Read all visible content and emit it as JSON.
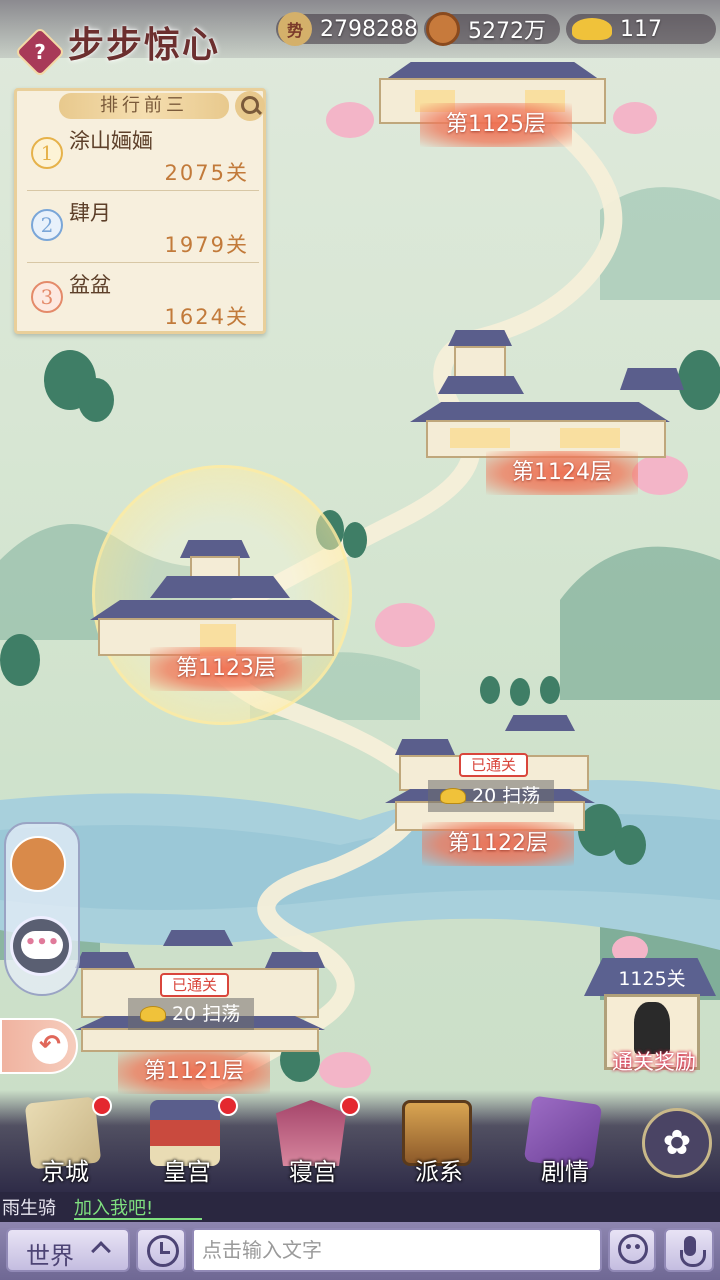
{
  "header": {
    "game_title": "步步惊心",
    "help_icon": "question-mark-icon",
    "resources": [
      {
        "icon": "status-seal-icon",
        "icon_text": "势",
        "value": "2798288",
        "color": "#d4b06a"
      },
      {
        "icon": "copper-coin-icon",
        "value": "5272万",
        "color": "#c77a3c"
      },
      {
        "icon": "gold-ingot-icon",
        "value": "117",
        "color": "#f0c23a"
      }
    ]
  },
  "ranking": {
    "title": "排行前三",
    "search_icon": "search-icon",
    "entries": [
      {
        "rank": "1",
        "name": "涂山婳婳",
        "level": "2075关",
        "color": "#e6b24a"
      },
      {
        "rank": "2",
        "name": "肆月",
        "level": "1979关",
        "color": "#7aa6d8"
      },
      {
        "rank": "3",
        "name": "盆盆",
        "level": "1624关",
        "color": "#e48a6a"
      }
    ]
  },
  "map": {
    "floors": [
      {
        "label": "第1125层",
        "cleared": false
      },
      {
        "label": "第1124层",
        "cleared": false
      },
      {
        "label": "第1123层",
        "cleared": false,
        "current": true
      },
      {
        "label": "第1122层",
        "cleared": true,
        "badge": "已通关",
        "sweep": "20 扫荡"
      },
      {
        "label": "第1121层",
        "cleared": true,
        "badge": "已通关",
        "sweep": "20 扫荡"
      }
    ]
  },
  "side": {
    "avatar_icon": "pet-avatar-icon",
    "chat_icon": "chat-bubble-icon",
    "chat_text": "•••",
    "back_icon": "back-arrow-icon",
    "back_glyph": "↶"
  },
  "reward": {
    "level": "1125关",
    "label": "通关奖励"
  },
  "nav": {
    "items": [
      {
        "label": "京城",
        "icon": "map-scroll-icon",
        "badge": true
      },
      {
        "label": "皇宫",
        "icon": "palace-icon",
        "badge": true
      },
      {
        "label": "寝宫",
        "icon": "bed-canopy-icon",
        "badge": true
      },
      {
        "label": "派系",
        "icon": "faction-emblem-icon",
        "badge": false
      },
      {
        "label": "剧情",
        "icon": "story-book-icon",
        "badge": false
      }
    ],
    "flower_icon": "flower-menu-icon",
    "flower_glyph": "✿"
  },
  "chat": {
    "ticker_sender": "雨生骑",
    "ticker_message": "加入我吧!",
    "channel_label": "世界",
    "history_icon": "history-clock-icon",
    "input_placeholder": "点击输入文字",
    "emoji_icon": "emoji-face-icon",
    "emoji_glyph": "••",
    "mic_icon": "microphone-icon"
  }
}
